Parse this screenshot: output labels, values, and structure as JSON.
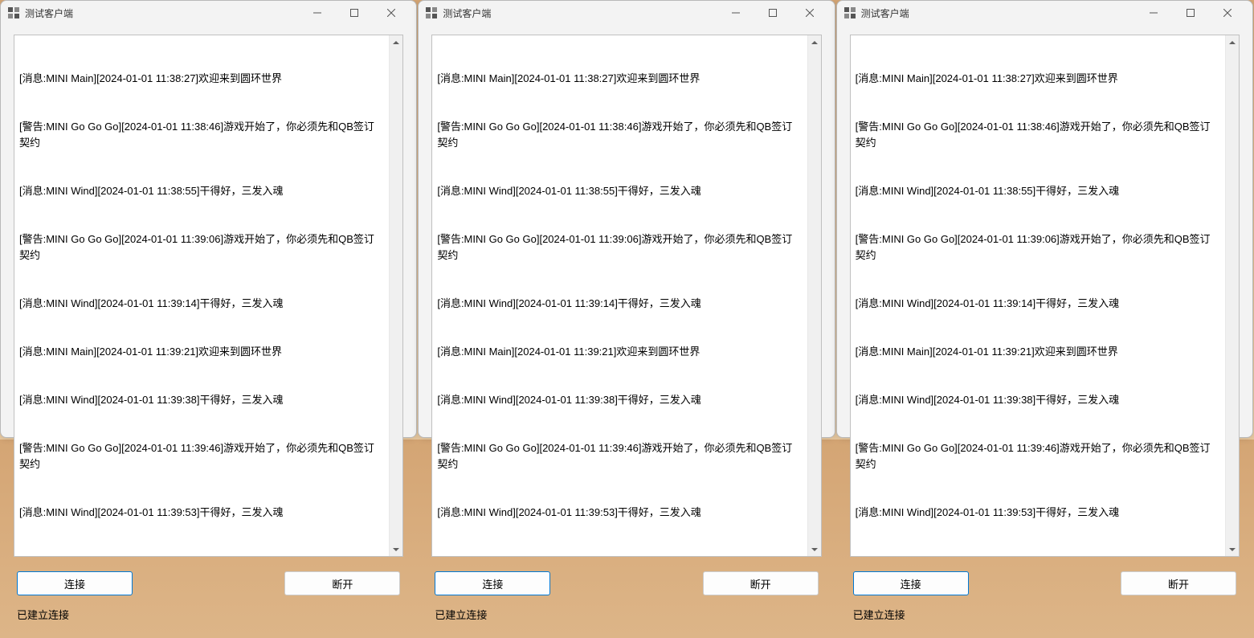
{
  "windows": [
    {
      "title": "测试客户端",
      "logs": [
        "[消息:MINI Main][2024-01-01 11:38:27]欢迎来到圆环世界",
        "[警告:MINI Go Go Go][2024-01-01 11:38:46]游戏开始了，你必须先和QB签订契约",
        "[消息:MINI Wind][2024-01-01 11:38:55]干得好，三发入魂",
        "[警告:MINI Go Go Go][2024-01-01 11:39:06]游戏开始了，你必须先和QB签订契约",
        "[消息:MINI Wind][2024-01-01 11:39:14]干得好，三发入魂",
        "[消息:MINI Main][2024-01-01 11:39:21]欢迎来到圆环世界",
        "[消息:MINI Wind][2024-01-01 11:39:38]干得好，三发入魂",
        "[警告:MINI Go Go Go][2024-01-01 11:39:46]游戏开始了，你必须先和QB签订契约",
        "[消息:MINI Wind][2024-01-01 11:39:53]干得好，三发入魂"
      ],
      "connect_label": "连接",
      "disconnect_label": "断开",
      "status": "已建立连接"
    },
    {
      "title": "测试客户端",
      "logs": [
        "[消息:MINI Main][2024-01-01 11:38:27]欢迎来到圆环世界",
        "[警告:MINI Go Go Go][2024-01-01 11:38:46]游戏开始了，你必须先和QB签订契约",
        "[消息:MINI Wind][2024-01-01 11:38:55]干得好，三发入魂",
        "[警告:MINI Go Go Go][2024-01-01 11:39:06]游戏开始了，你必须先和QB签订契约",
        "[消息:MINI Wind][2024-01-01 11:39:14]干得好，三发入魂",
        "[消息:MINI Main][2024-01-01 11:39:21]欢迎来到圆环世界",
        "[消息:MINI Wind][2024-01-01 11:39:38]干得好，三发入魂",
        "[警告:MINI Go Go Go][2024-01-01 11:39:46]游戏开始了，你必须先和QB签订契约",
        "[消息:MINI Wind][2024-01-01 11:39:53]干得好，三发入魂"
      ],
      "connect_label": "连接",
      "disconnect_label": "断开",
      "status": "已建立连接"
    },
    {
      "title": "测试客户端",
      "logs": [
        "[消息:MINI Main][2024-01-01 11:38:27]欢迎来到圆环世界",
        "[警告:MINI Go Go Go][2024-01-01 11:38:46]游戏开始了，你必须先和QB签订契约",
        "[消息:MINI Wind][2024-01-01 11:38:55]干得好，三发入魂",
        "[警告:MINI Go Go Go][2024-01-01 11:39:06]游戏开始了，你必须先和QB签订契约",
        "[消息:MINI Wind][2024-01-01 11:39:14]干得好，三发入魂",
        "[消息:MINI Main][2024-01-01 11:39:21]欢迎来到圆环世界",
        "[消息:MINI Wind][2024-01-01 11:39:38]干得好，三发入魂",
        "[警告:MINI Go Go Go][2024-01-01 11:39:46]游戏开始了，你必须先和QB签订契约",
        "[消息:MINI Wind][2024-01-01 11:39:53]干得好，三发入魂"
      ],
      "connect_label": "连接",
      "disconnect_label": "断开",
      "status": "已建立连接"
    }
  ]
}
